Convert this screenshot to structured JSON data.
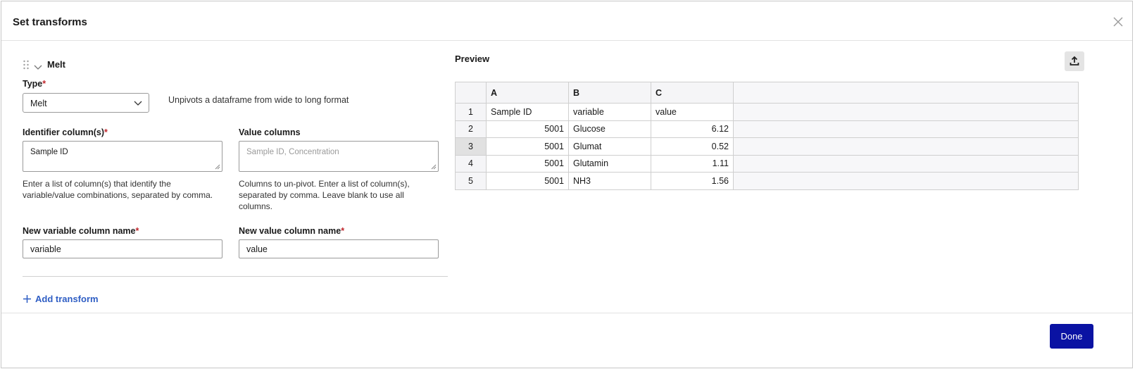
{
  "dialog": {
    "title": "Set transforms",
    "done_label": "Done"
  },
  "transform": {
    "name": "Melt",
    "type_label": "Type",
    "type_value": "Melt",
    "type_description": "Unpivots a dataframe from wide to long format",
    "identifier": {
      "label": "Identifier column(s)",
      "value": "Sample ID",
      "help": "Enter a list of column(s) that identify the variable/value combinations, separated by comma."
    },
    "value_columns": {
      "label": "Value columns",
      "placeholder": "Sample ID, Concentration",
      "help": "Columns to un-pivot. Enter a list of column(s), separated by comma. Leave blank to use all columns."
    },
    "new_variable": {
      "label": "New variable column name",
      "value": "variable"
    },
    "new_value": {
      "label": "New value column name",
      "value": "value"
    },
    "required_mark": "*"
  },
  "add_transform_label": "Add transform",
  "preview": {
    "label": "Preview",
    "columns": [
      "A",
      "B",
      "C"
    ],
    "rows": [
      {
        "num": "1",
        "a": "Sample ID",
        "b": "variable",
        "c": "value"
      },
      {
        "num": "2",
        "a": "5001",
        "b": "Glucose",
        "c": "6.12"
      },
      {
        "num": "3",
        "a": "5001",
        "b": "Glumat",
        "c": "0.52"
      },
      {
        "num": "4",
        "a": "5001",
        "b": "Glutamin",
        "c": "1.11"
      },
      {
        "num": "5",
        "a": "5001",
        "b": "NH3",
        "c": "1.56"
      }
    ],
    "selected_row": "3"
  },
  "icons": {
    "close": "close-icon",
    "drag": "drag-handle-icon",
    "collapse": "chevron-down-icon",
    "select_caret": "chevron-down-icon",
    "add": "plus-icon",
    "export": "upload-icon"
  },
  "colors": {
    "primary": "#0a12a3",
    "link": "#2f5ec4",
    "required": "#c0272d"
  }
}
